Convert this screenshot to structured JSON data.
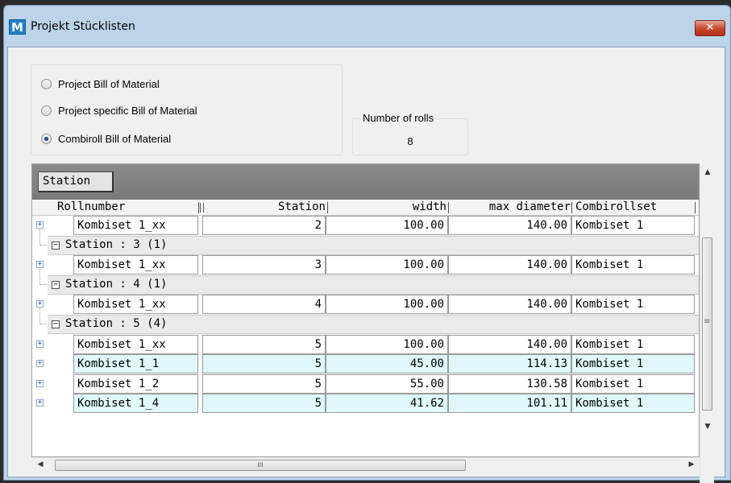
{
  "window": {
    "icon_letter": "M",
    "title": "Projekt Stücklisten",
    "close_glyph": "✕"
  },
  "bom_options": [
    {
      "label": "Project Bill of Material",
      "selected": false
    },
    {
      "label": "Project specific Bill of Material",
      "selected": false
    },
    {
      "label": "Combiroll Bill of Material",
      "selected": true
    }
  ],
  "rolls": {
    "legend": "Number of rolls",
    "value": "8"
  },
  "grid": {
    "group_chip": "Station",
    "columns": {
      "rollnumber": "Rollnumber",
      "station": "Station",
      "width": "width",
      "max_diameter": "max diameter",
      "combirollset": "Combirollset"
    },
    "rows": [
      {
        "type": "data",
        "expander": "+",
        "rollnumber": "Kombiset 1_xx",
        "station": "2",
        "width": "100.00",
        "max_diameter": "140.00",
        "combirollset": "Kombiset 1",
        "highlight": false
      },
      {
        "type": "group",
        "toggle": "−",
        "label": "Station : 3 (1)"
      },
      {
        "type": "data",
        "expander": "+",
        "rollnumber": "Kombiset 1_xx",
        "station": "3",
        "width": "100.00",
        "max_diameter": "140.00",
        "combirollset": "Kombiset 1",
        "highlight": false
      },
      {
        "type": "group",
        "toggle": "−",
        "label": "Station : 4 (1)"
      },
      {
        "type": "data",
        "expander": "+",
        "rollnumber": "Kombiset 1_xx",
        "station": "4",
        "width": "100.00",
        "max_diameter": "140.00",
        "combirollset": "Kombiset 1",
        "highlight": false
      },
      {
        "type": "group",
        "toggle": "−",
        "label": "Station : 5 (4)"
      },
      {
        "type": "data",
        "expander": "+",
        "rollnumber": "Kombiset 1_xx",
        "station": "5",
        "width": "100.00",
        "max_diameter": "140.00",
        "combirollset": "Kombiset 1",
        "highlight": false
      },
      {
        "type": "data",
        "expander": "+",
        "rollnumber": "Kombiset 1_1",
        "station": "5",
        "width": "45.00",
        "max_diameter": "114.13",
        "combirollset": "Kombiset 1",
        "highlight": true
      },
      {
        "type": "data",
        "expander": "+",
        "rollnumber": "Kombiset 1_2",
        "station": "5",
        "width": "55.00",
        "max_diameter": "130.58",
        "combirollset": "Kombiset 1",
        "highlight": false
      },
      {
        "type": "data",
        "expander": "+",
        "rollnumber": "Kombiset 1_4",
        "station": "5",
        "width": "41.62",
        "max_diameter": "101.11",
        "combirollset": "Kombiset 1",
        "highlight": true
      }
    ]
  },
  "scrollbars": {
    "up": "▲",
    "down": "▼",
    "left": "◀",
    "right": "▶",
    "v_grip": "≡",
    "h_grip": "III"
  },
  "colors": {
    "highlight_row": "#dff8f9",
    "group_panel": "#808080",
    "title_bar": "#bcd3e9",
    "close_button": "#c4452d"
  }
}
